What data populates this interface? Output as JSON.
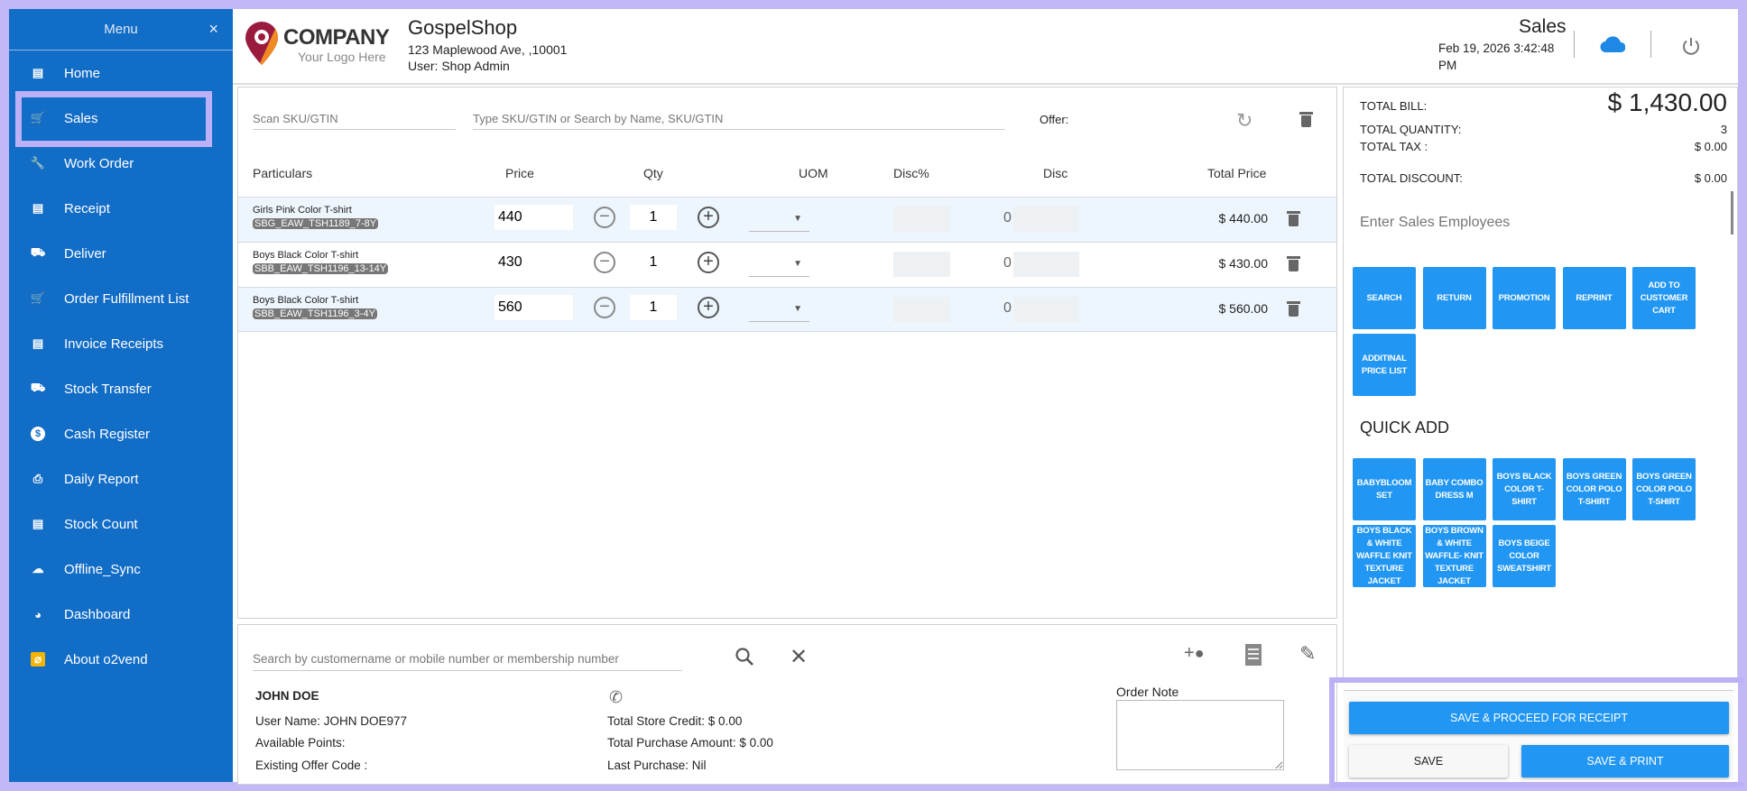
{
  "sidebar": {
    "title": "Menu",
    "close": "×",
    "items": [
      {
        "label": "Home",
        "icon": "store-icon"
      },
      {
        "label": "Sales",
        "icon": "cart-icon"
      },
      {
        "label": "Work Order",
        "icon": "wrench-icon"
      },
      {
        "label": "Receipt",
        "icon": "receipt-icon"
      },
      {
        "label": "Deliver",
        "icon": "truck-icon"
      },
      {
        "label": "Order Fulfillment List",
        "icon": "cart-icon"
      },
      {
        "label": "Invoice Receipts",
        "icon": "receipt-icon"
      },
      {
        "label": "Stock Transfer",
        "icon": "truck-icon"
      },
      {
        "label": "Cash Register",
        "icon": "dollar-icon"
      },
      {
        "label": "Daily Report",
        "icon": "printer-icon"
      },
      {
        "label": "Stock Count",
        "icon": "receipt-icon"
      },
      {
        "label": "Offline_Sync",
        "icon": "cloud-upload-icon"
      },
      {
        "label": "Dashboard",
        "icon": "pie-chart-icon"
      },
      {
        "label": "About o2vend",
        "icon": "about-icon"
      }
    ]
  },
  "header": {
    "logo_name": "COMPANY",
    "logo_tagline": "Your Logo Here",
    "shop": "GospelShop",
    "address": "123 Maplewood Ave, ,10001",
    "user": "User:  Shop Admin",
    "page_title": "Sales",
    "datetime_line1": "Feb 19, 2026 3:42:48",
    "datetime_line2": "PM"
  },
  "scan": {
    "sku_placeholder": "Scan SKU/GTIN",
    "search_placeholder": "Type SKU/GTIN or Search by Name, SKU/GTIN",
    "offer_label": "Offer:"
  },
  "table": {
    "headers": [
      "Particulars",
      "Price",
      "Qty",
      "UOM",
      "Disc%",
      "Disc",
      "Total Price"
    ],
    "rows": [
      {
        "name": "Girls Pink Color T-shirt",
        "sku": "SBG_EAW_TSH1189_7-8Y",
        "price": "440",
        "qty": "1",
        "disc": "0",
        "total": "$ 440.00"
      },
      {
        "name": "Boys Black Color T-shirt",
        "sku": "SBB_EAW_TSH1196_13-14Y",
        "price": "430",
        "qty": "1",
        "disc": "0",
        "total": "$ 430.00"
      },
      {
        "name": "Boys Black Color T-shirt",
        "sku": "SBB_EAW_TSH1196_3-4Y",
        "price": "560",
        "qty": "1",
        "disc": "0",
        "total": "$ 560.00"
      }
    ]
  },
  "customer": {
    "search_placeholder": "Search by customername or mobile number or membership number",
    "name": "JOHN DOE",
    "user_name": "User Name:  JOHN DOE977",
    "points": "Available Points:",
    "offer_code": "Existing Offer Code :",
    "store_credit": "Total Store Credit:  $  0.00",
    "purchase_amount": "Total Purchase Amount:  $ 0.00",
    "last_purchase": "Last Purchase:  Nil",
    "order_note_label": "Order Note"
  },
  "totals": {
    "bill_label": "TOTAL BILL:",
    "bill": "$ 1,430.00",
    "qty_label": "TOTAL QUANTITY:",
    "qty": "3",
    "tax_label": "TOTAL TAX :",
    "tax": "$ 0.00",
    "disc_label": "TOTAL DISCOUNT:",
    "disc": "$ 0.00",
    "employees_placeholder": "Enter Sales Employees"
  },
  "actions": [
    "SEARCH",
    "RETURN",
    "PROMOTION",
    "REPRINT",
    "ADD TO CUSTOMER CART",
    "ADDITINAL PRICE LIST"
  ],
  "quick_add": {
    "title": "QUICK ADD",
    "items": [
      "BABYBLOOM SET",
      "BABY COMBO DRESS M",
      "BOYS BLACK COLOR T-SHIRT",
      "BOYS GREEN COLOR POLO T-SHIRT",
      "BOYS GREEN COLOR POLO T-SHIRT",
      "BOYS BLACK & WHITE WAFFLE KNIT TEXTURE JACKET",
      "BOYS BROWN & WHITE WAFFLE- KNIT TEXTURE JACKET",
      "BOYS BEIGE COLOR SWEATSHIRT"
    ]
  },
  "footer": {
    "proceed": "SAVE & PROCEED FOR RECEIPT",
    "save": "SAVE",
    "save_print": "SAVE & PRINT"
  },
  "colors": {
    "sidebar": "#126dc7",
    "accent": "#2196f3",
    "highlight": "#bcb0f6"
  }
}
